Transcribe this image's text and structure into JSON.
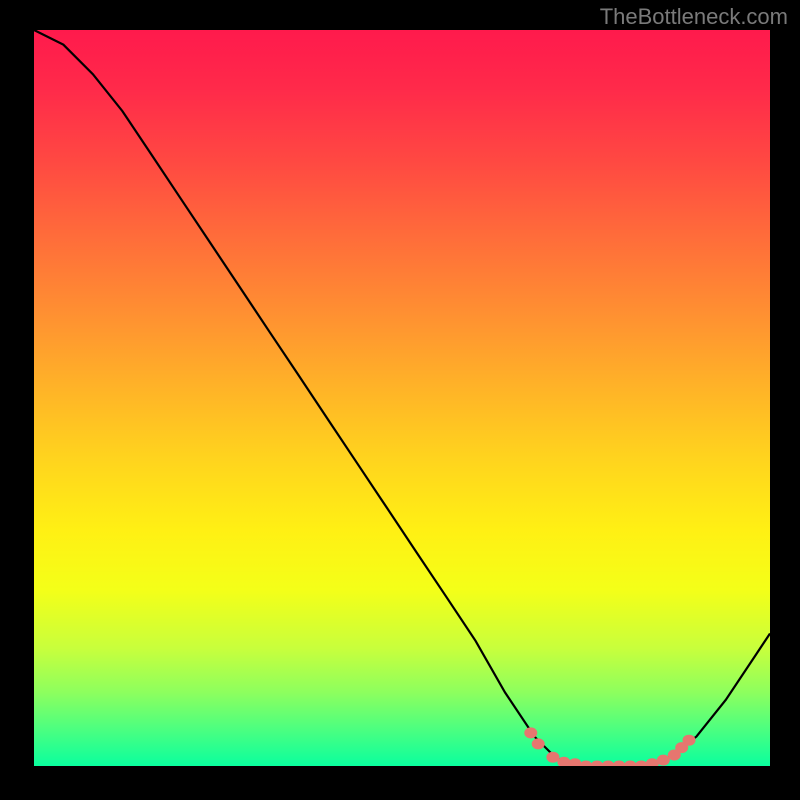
{
  "watermark": "TheBottleneck.com",
  "chart_data": {
    "type": "line",
    "title": "",
    "xlabel": "",
    "ylabel": "",
    "xlim": [
      0,
      100
    ],
    "ylim": [
      0,
      100
    ],
    "grid": false,
    "curve": {
      "name": "bottleneck-curve",
      "color": "#000000",
      "points": [
        {
          "x": 0,
          "y": 100
        },
        {
          "x": 4,
          "y": 98
        },
        {
          "x": 8,
          "y": 94
        },
        {
          "x": 12,
          "y": 89
        },
        {
          "x": 16,
          "y": 83
        },
        {
          "x": 20,
          "y": 77
        },
        {
          "x": 24,
          "y": 71
        },
        {
          "x": 28,
          "y": 65
        },
        {
          "x": 32,
          "y": 59
        },
        {
          "x": 36,
          "y": 53
        },
        {
          "x": 40,
          "y": 47
        },
        {
          "x": 44,
          "y": 41
        },
        {
          "x": 48,
          "y": 35
        },
        {
          "x": 52,
          "y": 29
        },
        {
          "x": 56,
          "y": 23
        },
        {
          "x": 60,
          "y": 17
        },
        {
          "x": 64,
          "y": 10
        },
        {
          "x": 68,
          "y": 4
        },
        {
          "x": 71,
          "y": 1
        },
        {
          "x": 74,
          "y": 0
        },
        {
          "x": 78,
          "y": 0
        },
        {
          "x": 82,
          "y": 0
        },
        {
          "x": 86,
          "y": 1
        },
        {
          "x": 90,
          "y": 4
        },
        {
          "x": 94,
          "y": 9
        },
        {
          "x": 98,
          "y": 15
        },
        {
          "x": 100,
          "y": 18
        }
      ]
    },
    "markers": {
      "name": "highlighted-range",
      "color": "#e6766f",
      "points": [
        {
          "x": 67.5,
          "y": 4.5
        },
        {
          "x": 68.5,
          "y": 3.0
        },
        {
          "x": 70.5,
          "y": 1.2
        },
        {
          "x": 72.0,
          "y": 0.5
        },
        {
          "x": 73.5,
          "y": 0.3
        },
        {
          "x": 75.0,
          "y": 0.0
        },
        {
          "x": 76.5,
          "y": 0.0
        },
        {
          "x": 78.0,
          "y": 0.0
        },
        {
          "x": 79.5,
          "y": 0.0
        },
        {
          "x": 81.0,
          "y": 0.0
        },
        {
          "x": 82.5,
          "y": 0.0
        },
        {
          "x": 84.0,
          "y": 0.3
        },
        {
          "x": 85.5,
          "y": 0.8
        },
        {
          "x": 87.0,
          "y": 1.5
        },
        {
          "x": 88.0,
          "y": 2.5
        },
        {
          "x": 89.0,
          "y": 3.5
        }
      ]
    }
  }
}
